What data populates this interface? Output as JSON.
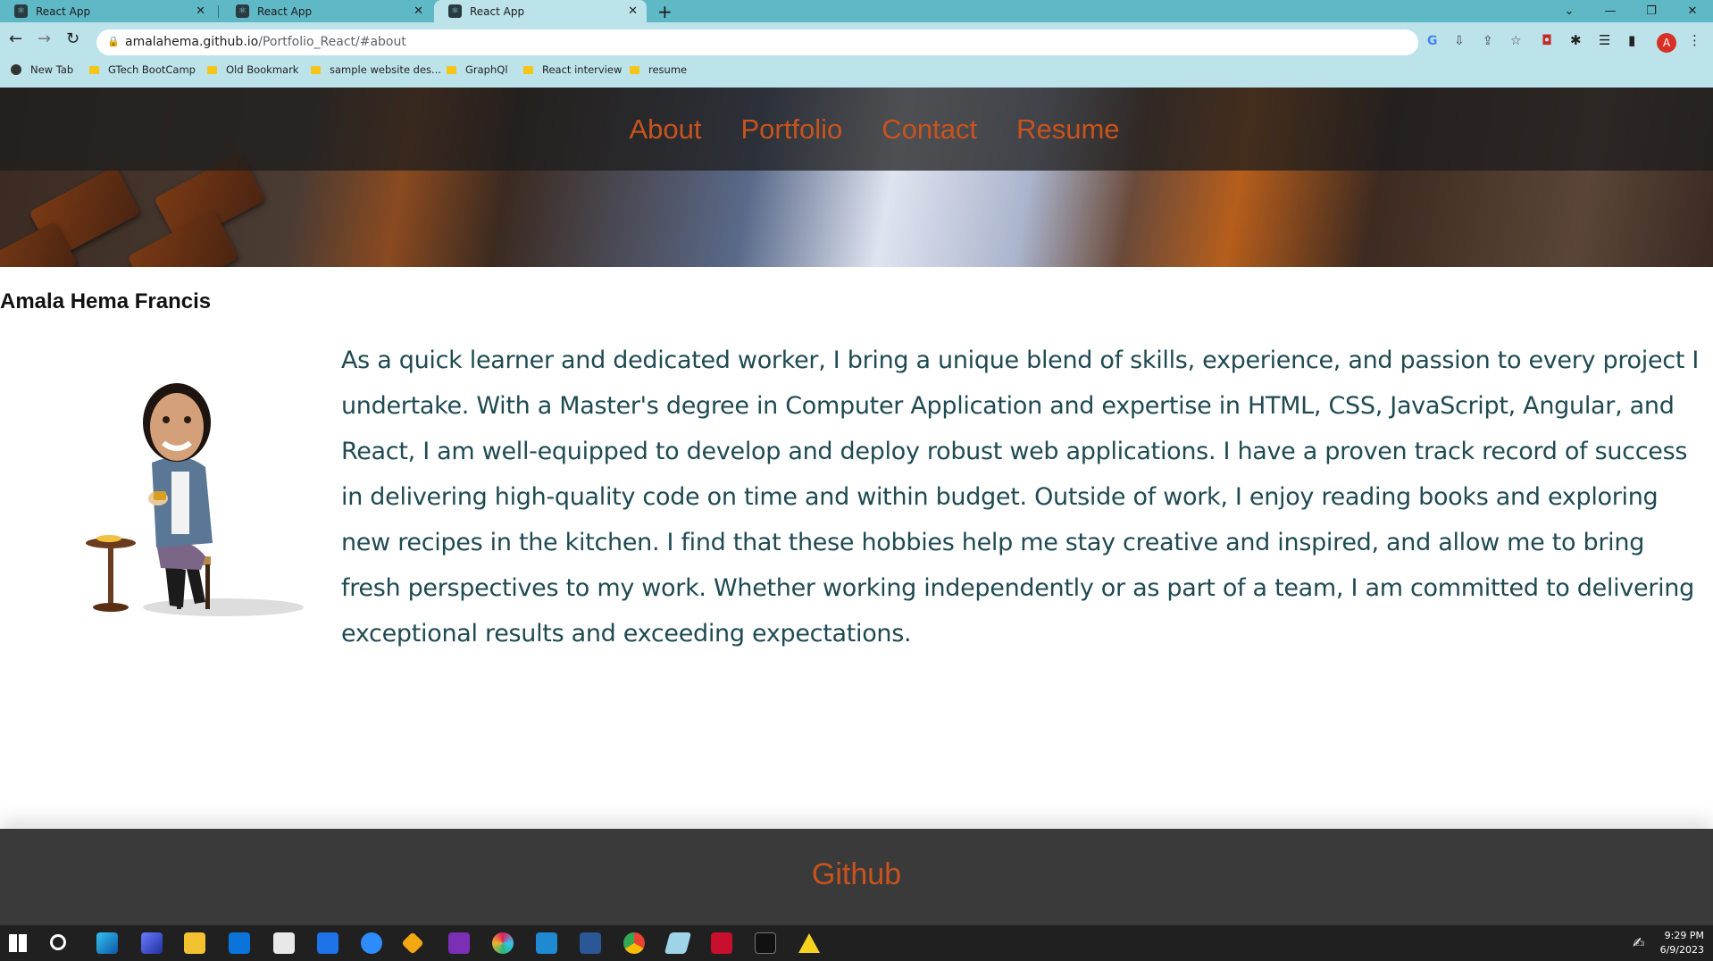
{
  "browser": {
    "tabs": [
      {
        "title": "React App",
        "active": false
      },
      {
        "title": "React App",
        "active": false
      },
      {
        "title": "React App",
        "active": true
      }
    ],
    "url_host": "amalahema.github.io",
    "url_path": "/Portfolio_React/#about",
    "bookmarks": [
      "New Tab",
      "GTech BootCamp",
      "Old Bookmark",
      "sample website des...",
      "GraphQl",
      "React interview",
      "resume"
    ],
    "profile_initial": "A"
  },
  "nav": {
    "links": [
      "About",
      "Portfolio",
      "Contact",
      "Resume"
    ]
  },
  "about": {
    "name": "Amala Hema Francis",
    "text": "As a quick learner and dedicated worker, I bring a unique blend of skills, experience, and passion to every project I undertake. With a Master's degree in Computer Application and expertise in HTML, CSS, JavaScript, Angular, and React, I am well-equipped to develop and deploy robust web applications. I have a proven track record of success in delivering high-quality code on time and within budget. Outside of work, I enjoy reading books and exploring new recipes in the kitchen. I find that these hobbies help me stay creative and inspired, and allow me to bring fresh perspectives to my work. Whether working independently or as part of a team, I am committed to delivering exceptional results and exceeding expectations."
  },
  "footer": {
    "link": "Github"
  },
  "taskbar": {
    "time": "9:29 PM",
    "date": "6/9/2023"
  },
  "colors": {
    "accent": "#c9531c",
    "about_text": "#1f4a52",
    "tabstrip": "#5fb8c6",
    "toolbar": "#bce3ea"
  }
}
